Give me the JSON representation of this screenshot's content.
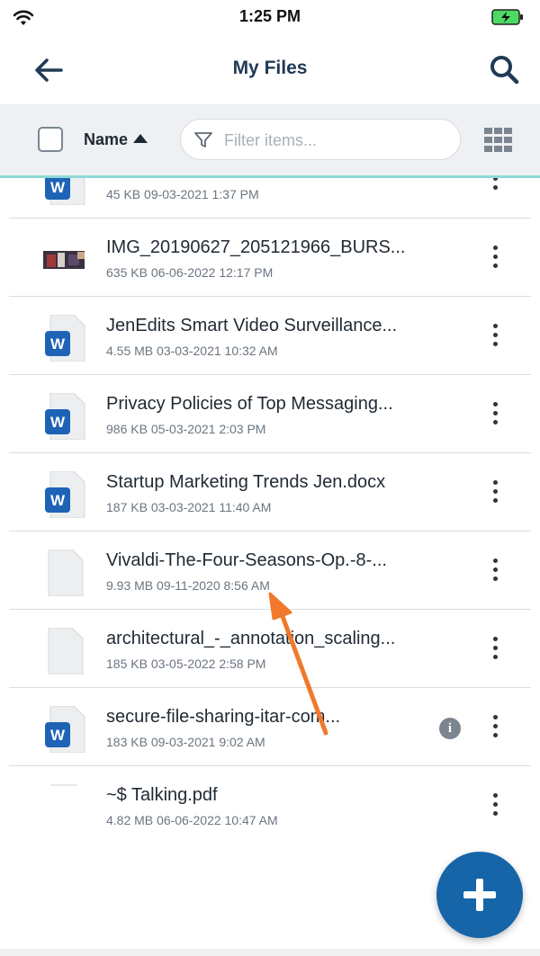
{
  "status_bar": {
    "time": "1:25 PM"
  },
  "header": {
    "title": "My Files"
  },
  "toolbar": {
    "sort_label": "Name",
    "filter_placeholder": "Filter items..."
  },
  "files": [
    {
      "name": "",
      "meta": "45 KB 09-03-2021 1:37 PM",
      "type": "word"
    },
    {
      "name": "IMG_20190627_205121966_BURS...",
      "meta": "635 KB 06-06-2022 12:17 PM",
      "type": "image"
    },
    {
      "name": "JenEdits Smart Video Surveillance...",
      "meta": "4.55 MB 03-03-2021 10:32 AM",
      "type": "word"
    },
    {
      "name": "Privacy Policies of Top Messaging...",
      "meta": "986 KB 05-03-2021 2:03 PM",
      "type": "word"
    },
    {
      "name": "Startup Marketing Trends Jen.docx",
      "meta": "187 KB 03-03-2021 11:40 AM",
      "type": "word"
    },
    {
      "name": "Vivaldi-The-Four-Seasons-Op.-8-...",
      "meta": "9.93 MB 09-11-2020 8:56 AM",
      "type": "generic"
    },
    {
      "name": "architectural_-_annotation_scaling...",
      "meta": "185 KB 03-05-2022 2:58 PM",
      "type": "generic"
    },
    {
      "name": "secure-file-sharing-itar-com...",
      "meta": "183 KB 09-03-2021 9:02 AM",
      "type": "word",
      "info": true
    },
    {
      "name": "~$ Talking.pdf",
      "meta": "4.82 MB 06-06-2022 10:47 AM",
      "type": "blank"
    }
  ],
  "icons": {
    "word_badge_color": "#1e63b6",
    "word_badge_letter": "W",
    "fab_color": "#1565a8",
    "accent_line": "#8fd9d6"
  }
}
